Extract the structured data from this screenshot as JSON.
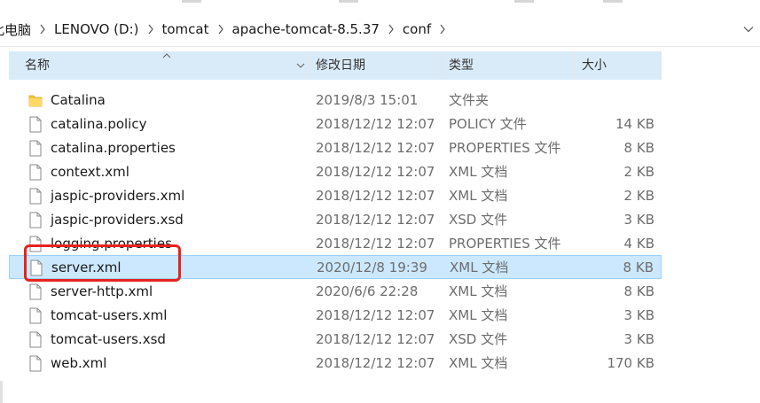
{
  "breadcrumb": {
    "items": [
      "此电脑",
      "LENOVO (D:)",
      "tomcat",
      "apache-tomcat-8.5.37",
      "conf"
    ]
  },
  "columns": {
    "name": "名称",
    "date": "修改日期",
    "type": "类型",
    "size": "大小"
  },
  "files": [
    {
      "name": "Catalina",
      "date": "2019/8/3 15:01",
      "type": "文件夹",
      "size": "",
      "icon": "folder-icon"
    },
    {
      "name": "catalina.policy",
      "date": "2018/12/12 12:07",
      "type": "POLICY 文件",
      "size": "14 KB",
      "icon": "file-icon"
    },
    {
      "name": "catalina.properties",
      "date": "2018/12/12 12:07",
      "type": "PROPERTIES 文件",
      "size": "8 KB",
      "icon": "file-icon"
    },
    {
      "name": "context.xml",
      "date": "2018/12/12 12:07",
      "type": "XML 文档",
      "size": "2 KB",
      "icon": "file-icon"
    },
    {
      "name": "jaspic-providers.xml",
      "date": "2018/12/12 12:07",
      "type": "XML 文档",
      "size": "2 KB",
      "icon": "file-icon"
    },
    {
      "name": "jaspic-providers.xsd",
      "date": "2018/12/12 12:07",
      "type": "XSD 文件",
      "size": "3 KB",
      "icon": "file-icon"
    },
    {
      "name": "logging.properties",
      "date": "2018/12/12 12:07",
      "type": "PROPERTIES 文件",
      "size": "4 KB",
      "icon": "file-icon"
    },
    {
      "name": "server.xml",
      "date": "2020/12/8 19:39",
      "type": "XML 文档",
      "size": "8 KB",
      "icon": "file-icon",
      "selected": true
    },
    {
      "name": "server-http.xml",
      "date": "2020/6/6 22:28",
      "type": "XML 文档",
      "size": "8 KB",
      "icon": "file-icon"
    },
    {
      "name": "tomcat-users.xml",
      "date": "2018/12/12 12:07",
      "type": "XML 文档",
      "size": "3 KB",
      "icon": "file-icon"
    },
    {
      "name": "tomcat-users.xsd",
      "date": "2018/12/12 12:07",
      "type": "XSD 文件",
      "size": "3 KB",
      "icon": "file-icon"
    },
    {
      "name": "web.xml",
      "date": "2018/12/12 12:07",
      "type": "XML 文档",
      "size": "170 KB",
      "icon": "file-icon"
    }
  ],
  "colors": {
    "selected_bg": "#cce8ff",
    "header_bg": "#d9ebf9",
    "annotation": "#e8231f"
  }
}
